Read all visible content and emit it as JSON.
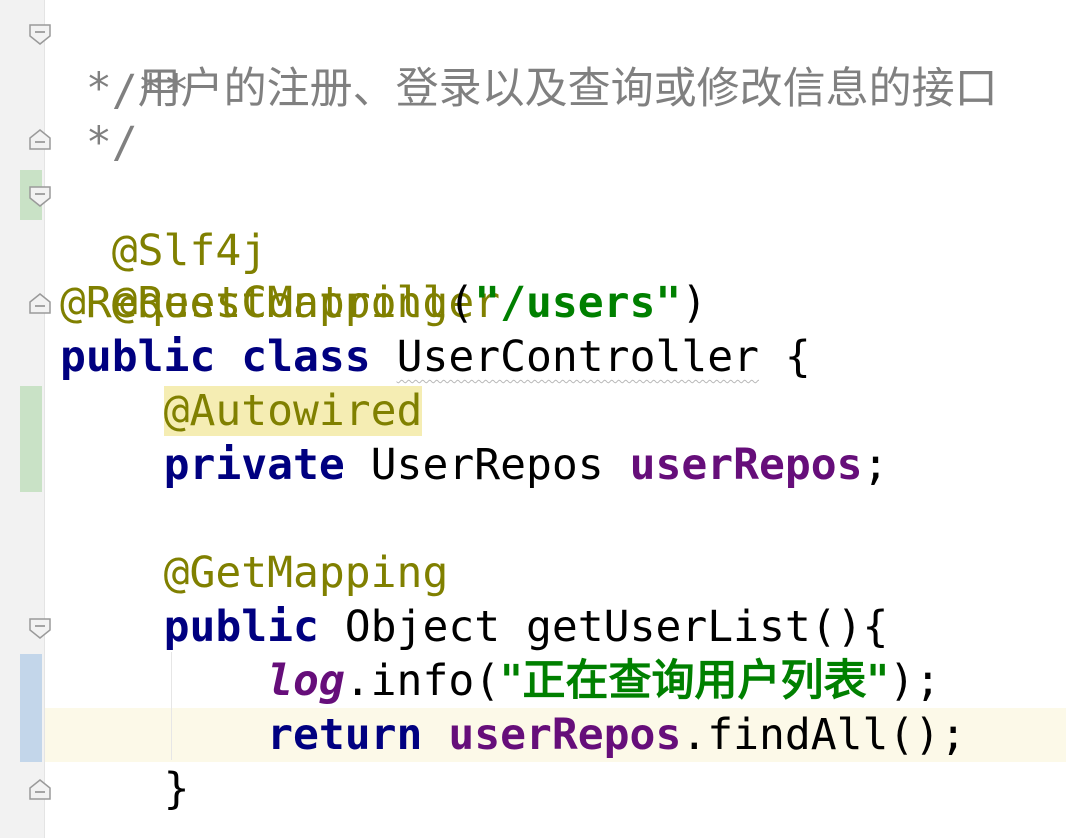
{
  "editor": {
    "language": "java",
    "colors": {
      "background": "#ffffff",
      "gutter": "#f2f2f2",
      "current_line": "#fcf9e8",
      "keyword": "#000080",
      "annotation": "#808000",
      "string": "#008000",
      "field": "#660e7a",
      "comment": "#808080",
      "vcs_added": "#c9e2c6",
      "vcs_modified": "#c3d6ea"
    },
    "lines": {
      "l1": {
        "text": "/**"
      },
      "l2": {
        "star": "* ",
        "text": "用户的注册、登录以及查询或修改信息的接口"
      },
      "l3": {
        "text": "*/"
      },
      "l4": {
        "annotation": "@Slf4j"
      },
      "l5": {
        "annotation": "@RestController"
      },
      "l6": {
        "annotation": "@RequestMapping",
        "open": "(",
        "string": "\"/users\"",
        "close": ")"
      },
      "l7": {
        "kw1": "public",
        "kw2": "class",
        "name": "UserController",
        "brace": " {"
      },
      "l8": {
        "annotation": "@Autowired"
      },
      "l9": {
        "kw": "private",
        "type": "UserRepos",
        "field": "userRepos",
        "semi": ";"
      },
      "l11": {
        "annotation": "@GetMapping"
      },
      "l12": {
        "kw": "public",
        "rest": " Object getUserList(){"
      },
      "l13": {
        "static_field": "log",
        "call": ".info(",
        "string": "\"正在查询用户列表\"",
        "end": ");"
      },
      "l14": {
        "kw": "return",
        "field": "userRepos",
        "call": ".findAll();"
      },
      "l15": {
        "text": "}"
      }
    }
  }
}
